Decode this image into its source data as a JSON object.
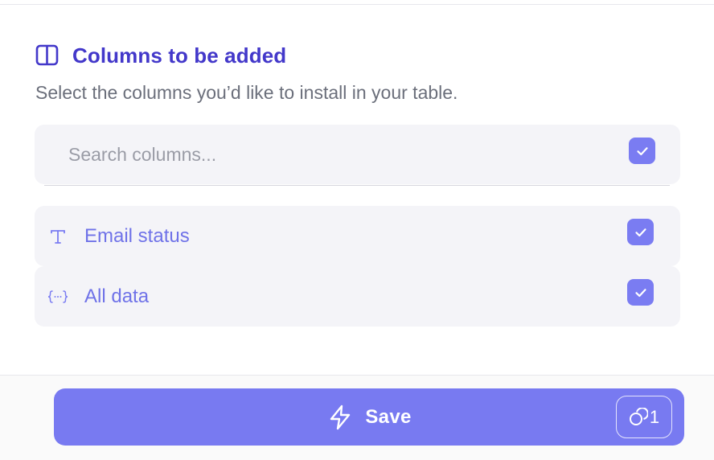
{
  "section": {
    "title": "Columns to be added",
    "subtitle": "Select the columns you’d like to install in your table.",
    "icon": "columns-icon"
  },
  "search": {
    "placeholder": "Search columns...",
    "value": "",
    "select_all_checked": true
  },
  "columns": [
    {
      "label": "Email status",
      "icon": "text-type-icon",
      "glyph": "T",
      "checked": true
    },
    {
      "label": "All data",
      "icon": "json-object-icon",
      "glyph": "{···}",
      "checked": true
    }
  ],
  "save_button": {
    "label": "Save",
    "icon": "bolt-icon",
    "credit_icon": "coins-icon",
    "credit_count": "1"
  },
  "colors": {
    "accent": "#787af1",
    "title": "#4338ca",
    "row_bg": "#f4f4f8",
    "label": "#6f72e8"
  }
}
